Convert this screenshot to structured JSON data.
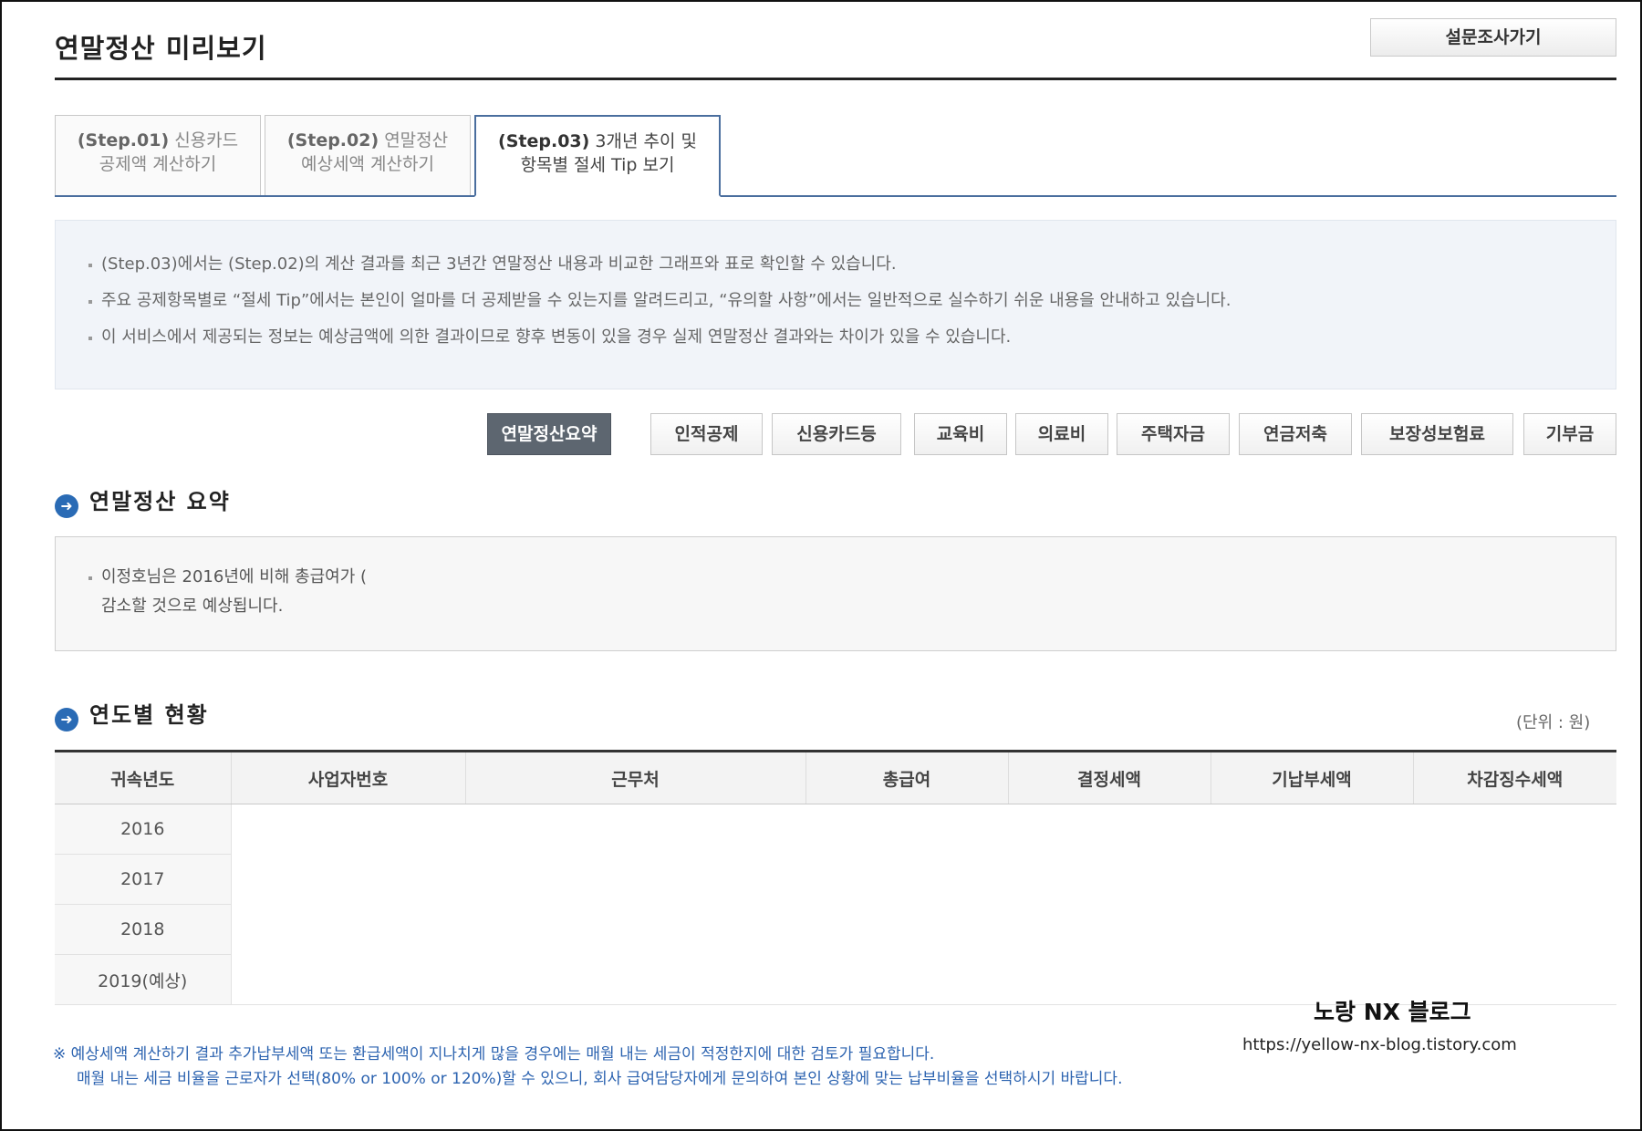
{
  "page": {
    "title": "연말정산 미리보기",
    "survey_button": "설문조사가기"
  },
  "step_tabs": [
    {
      "num": "(Step.01)",
      "text1": "신용카드",
      "text2": "공제액 계산하기"
    },
    {
      "num": "(Step.02)",
      "text1": "연말정산",
      "text2": "예상세액 계산하기"
    },
    {
      "num": "(Step.03)",
      "text1": "3개년 추이 및",
      "text2": "항목별 절세 Tip 보기"
    }
  ],
  "active_step": "(Step.03)",
  "notice": [
    "(Step.03)에서는 (Step.02)의 계산 결과를 최근 3년간 연말정산 내용과 비교한 그래프와 표로 확인할 수 있습니다.",
    "주요 공제항목별로 “절세 Tip”에서는 본인이 얼마를 더 공제받을 수 있는지를 알려드리고, “유의할 사항”에서는 일반적으로 실수하기 쉬운 내용을 안내하고 있습니다.",
    "이 서비스에서 제공되는 정보는 예상금액에 의한 결과이므로 향후 변동이 있을 경우 실제 연말정산 결과와는 차이가 있을 수 있습니다."
  ],
  "category_tabs": [
    "연말정산요약",
    "인적공제",
    "신용카드등",
    "교육비",
    "의료비",
    "주택자금",
    "연금저축",
    "보장성보험료",
    "기부금"
  ],
  "active_category": "연말정산요약",
  "summary": {
    "heading": "연말정산 요약",
    "line1": "이정호님은 2016년에 비해 총급여가 (",
    "line2": "감소할 것으로 예상됩니다."
  },
  "yearly": {
    "heading": "연도별 현황",
    "unit": "(단위 : 원)",
    "columns": [
      "귀속년도",
      "사업자번호",
      "근무처",
      "총급여",
      "결정세액",
      "기납부세액",
      "차감징수세액"
    ],
    "rows": [
      "2016",
      "2017",
      "2018",
      "2019(예상)"
    ]
  },
  "watermark": {
    "name": "노랑 NX 블로그",
    "url": "https://yellow-nx-blog.tistory.com"
  },
  "footnote": {
    "line1": "※ 예상세액 계산하기 결과 추가납부세액 또는 환급세액이 지나치게 많을 경우에는 매월 내는 세금이 적정한지에 대한 검토가 필요합니다.",
    "line2": "매월 내는 세금 비율을 근로자가 선택(80% or 100% or 120%)할 수 있으니, 회사 급여담당자에게 문의하여 본인 상황에 맞는 납부비율을 선택하시기 바랍니다."
  },
  "colors": {
    "accent": "#4a6e9e",
    "active_tab": "#5d6670",
    "bullet_icon": "#2a6bb5",
    "footnote": "#2c63b0"
  },
  "icons": {
    "section_bullet": "arrow-circle-icon"
  }
}
